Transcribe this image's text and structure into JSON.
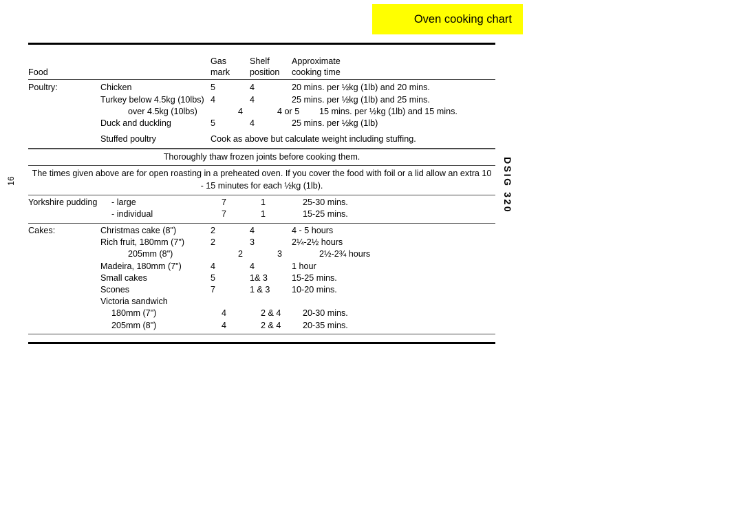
{
  "header": {
    "title": "Oven cooking chart",
    "banner_color": "#ffff00"
  },
  "side": {
    "page_number": "16",
    "model_code": "DSIG 320"
  },
  "table": {
    "columns": {
      "food": {
        "line1": "",
        "line2": "Food"
      },
      "gas": {
        "line1": "Gas",
        "line2": "mark"
      },
      "shelf": {
        "line1": "Shelf",
        "line2": "position"
      },
      "time": {
        "line1": "Approximate",
        "line2": "cooking time"
      }
    },
    "poultry": {
      "group_label": "Poultry:",
      "rows": [
        {
          "item": "Chicken",
          "gas": "5",
          "shelf": "4",
          "time": "20 mins. per ½kg (1lb) and 20 mins."
        },
        {
          "item": "Turkey below 4.5kg (10lbs)",
          "gas": "4",
          "shelf": "4",
          "time": "25 mins. per ½kg (1lb) and 25 mins."
        },
        {
          "item": "over 4.5kg (10lbs)",
          "gas": "4",
          "shelf": "4 or 5",
          "time": "15 mins. per ½kg (1lb) and 15 mins."
        },
        {
          "item": "Duck and duckling",
          "gas": "5",
          "shelf": "4",
          "time": "25 mins. per ½kg (1lb)"
        }
      ],
      "stuffed": {
        "item": "Stuffed poultry",
        "text": "Cook as above but calculate weight including stuffing."
      }
    },
    "notes": [
      "Thoroughly thaw frozen joints before cooking them.",
      "The times given above are for open roasting in a preheated oven. If you cover the food with foil or a lid allow an extra 10 - 15 minutes  for each ½kg (1lb)."
    ],
    "yorkshire": {
      "group_label": "Yorkshire pudding",
      "rows": [
        {
          "item": "- large",
          "gas": "7",
          "shelf": "1",
          "time": "25-30 mins."
        },
        {
          "item": "- individual",
          "gas": "7",
          "shelf": "1",
          "time": "15-25 mins."
        }
      ]
    },
    "cakes": {
      "group_label": "Cakes:",
      "rows": [
        {
          "item": "Christmas cake (8\")",
          "gas": "2",
          "shelf": "4",
          "time": "4 - 5 hours"
        },
        {
          "item": "Rich fruit,   180mm (7\")",
          "gas": "2",
          "shelf": "3",
          "time": "2¼-2½ hours"
        },
        {
          "item": "205mm (8\")",
          "gas": "2",
          "shelf": "3",
          "time": "2½-2¾ hours"
        },
        {
          "item": "Madeira,    180mm (7\")",
          "gas": "4",
          "shelf": "4",
          "time": "1 hour"
        },
        {
          "item": "Small cakes",
          "gas": "5",
          "shelf": "1& 3",
          "time": "15-25 mins."
        },
        {
          "item": "Scones",
          "gas": "7",
          "shelf": "1 & 3",
          "time": "10-20 mins."
        },
        {
          "item": "Victoria sandwich",
          "gas": "",
          "shelf": "",
          "time": ""
        },
        {
          "item": "180mm (7\")",
          "gas": "4",
          "shelf": "2 & 4",
          "time": "20-30 mins."
        },
        {
          "item": "205mm (8\")",
          "gas": "4",
          "shelf": "2 & 4",
          "time": "20-35 mins."
        }
      ]
    }
  }
}
